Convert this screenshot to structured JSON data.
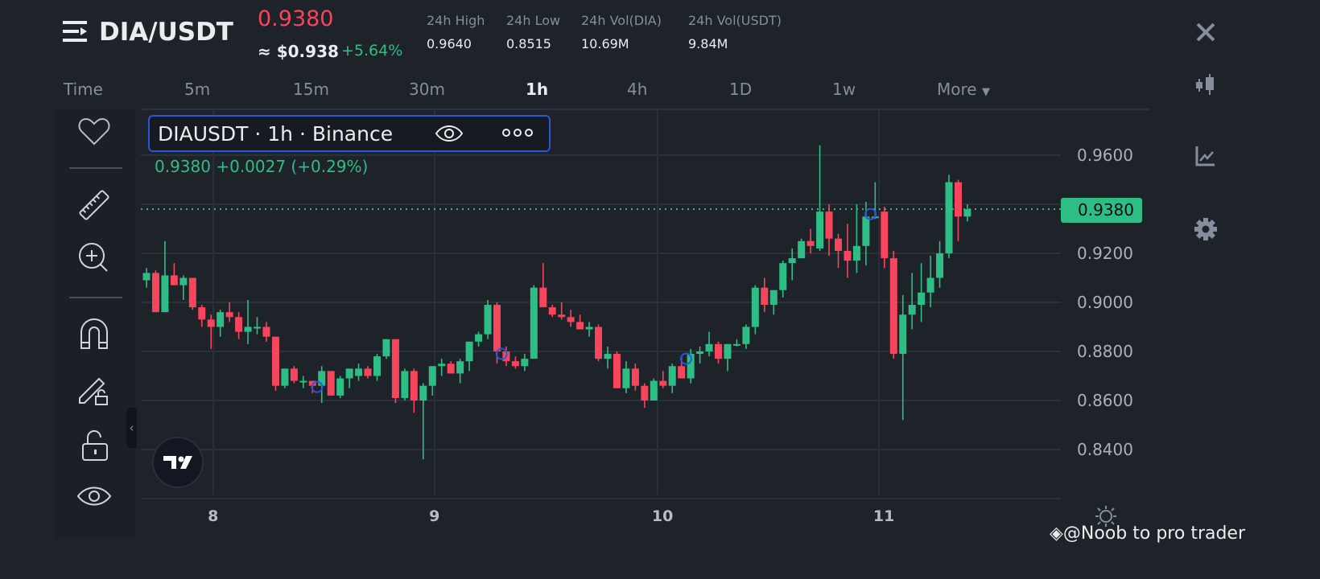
{
  "header": {
    "pair": "DIA/USDT",
    "last_price": "0.9380",
    "usd_price": "≈ $0.938",
    "change_pct": "+5.64%",
    "stats": [
      {
        "label": "24h High",
        "value": "0.9640"
      },
      {
        "label": "24h Low",
        "value": "0.8515"
      },
      {
        "label": "24h Vol(DIA)",
        "value": "10.69M"
      },
      {
        "label": "24h Vol(USDT)",
        "value": "9.84M"
      }
    ]
  },
  "intervals": [
    "Time",
    "5m",
    "15m",
    "30m",
    "1h",
    "4h",
    "1D",
    "1w",
    "More"
  ],
  "active_interval": "1h",
  "legend": {
    "title": "DIAUSDT · 1h · Binance",
    "values": "0.9380  +0.0027 (+0.29%)"
  },
  "current_price_tag": "0.9380",
  "watermark": "@Noob to pro trader",
  "colors": {
    "up": "#2ebd85",
    "down": "#f6465d",
    "accent": "#2c56d6",
    "bg": "#1e2229"
  },
  "chart_data": {
    "type": "candlestick",
    "y_ticks": [
      "0.9600",
      "0.9200",
      "0.9000",
      "0.8800",
      "0.8600",
      "0.8400"
    ],
    "y_tick_values": [
      0.96,
      0.92,
      0.9,
      0.88,
      0.86,
      0.84
    ],
    "x_ticks": [
      {
        "label": "8",
        "index": 7.25
      },
      {
        "label": "9",
        "index": 31.25
      },
      {
        "label": "10",
        "index": 55.4
      },
      {
        "label": "11",
        "index": 79.4
      }
    ],
    "current_price": 0.938,
    "markers": [
      {
        "index": 18.5,
        "price": 0.8655
      },
      {
        "index": 38.5,
        "price": 0.879
      },
      {
        "index": 58.5,
        "price": 0.877
      },
      {
        "index": 78.5,
        "price": 0.936
      }
    ],
    "ohlc": [
      [
        0.909,
        0.914,
        0.906,
        0.912
      ],
      [
        0.912,
        0.913,
        0.896,
        0.896
      ],
      [
        0.896,
        0.925,
        0.896,
        0.911
      ],
      [
        0.911,
        0.916,
        0.907,
        0.907
      ],
      [
        0.907,
        0.911,
        0.901,
        0.91
      ],
      [
        0.91,
        0.91,
        0.897,
        0.898
      ],
      [
        0.898,
        0.899,
        0.89,
        0.893
      ],
      [
        0.893,
        0.895,
        0.881,
        0.89
      ],
      [
        0.89,
        0.897,
        0.886,
        0.896
      ],
      [
        0.896,
        0.9,
        0.892,
        0.894
      ],
      [
        0.894,
        0.896,
        0.885,
        0.888
      ],
      [
        0.888,
        0.901,
        0.883,
        0.89
      ],
      [
        0.89,
        0.894,
        0.887,
        0.89
      ],
      [
        0.89,
        0.892,
        0.884,
        0.886
      ],
      [
        0.886,
        0.886,
        0.864,
        0.866
      ],
      [
        0.866,
        0.873,
        0.865,
        0.873
      ],
      [
        0.873,
        0.874,
        0.867,
        0.868
      ],
      [
        0.868,
        0.87,
        0.865,
        0.868
      ],
      [
        0.868,
        0.868,
        0.863,
        0.866
      ],
      [
        0.866,
        0.874,
        0.859,
        0.872
      ],
      [
        0.872,
        0.872,
        0.862,
        0.862
      ],
      [
        0.862,
        0.87,
        0.861,
        0.869
      ],
      [
        0.869,
        0.872,
        0.865,
        0.873
      ],
      [
        0.87,
        0.875,
        0.868,
        0.873
      ],
      [
        0.873,
        0.874,
        0.869,
        0.87
      ],
      [
        0.87,
        0.879,
        0.868,
        0.878
      ],
      [
        0.878,
        0.885,
        0.877,
        0.885
      ],
      [
        0.885,
        0.885,
        0.859,
        0.861
      ],
      [
        0.861,
        0.873,
        0.86,
        0.872
      ],
      [
        0.872,
        0.873,
        0.855,
        0.86
      ],
      [
        0.86,
        0.867,
        0.836,
        0.866
      ],
      [
        0.866,
        0.874,
        0.862,
        0.874
      ],
      [
        0.874,
        0.877,
        0.87,
        0.875
      ],
      [
        0.875,
        0.876,
        0.871,
        0.871
      ],
      [
        0.871,
        0.877,
        0.867,
        0.876
      ],
      [
        0.876,
        0.884,
        0.872,
        0.884
      ],
      [
        0.884,
        0.888,
        0.882,
        0.887
      ],
      [
        0.887,
        0.901,
        0.885,
        0.899
      ],
      [
        0.899,
        0.9,
        0.875,
        0.88
      ],
      [
        0.88,
        0.882,
        0.874,
        0.876
      ],
      [
        0.876,
        0.878,
        0.873,
        0.874
      ],
      [
        0.874,
        0.879,
        0.872,
        0.877
      ],
      [
        0.877,
        0.907,
        0.877,
        0.906
      ],
      [
        0.906,
        0.916,
        0.898,
        0.898
      ],
      [
        0.898,
        0.899,
        0.894,
        0.895
      ],
      [
        0.895,
        0.9,
        0.893,
        0.894
      ],
      [
        0.894,
        0.897,
        0.89,
        0.892
      ],
      [
        0.892,
        0.895,
        0.889,
        0.889
      ],
      [
        0.889,
        0.892,
        0.886,
        0.89
      ],
      [
        0.89,
        0.891,
        0.876,
        0.877
      ],
      [
        0.877,
        0.882,
        0.873,
        0.879
      ],
      [
        0.879,
        0.88,
        0.865,
        0.865
      ],
      [
        0.865,
        0.876,
        0.863,
        0.873
      ],
      [
        0.873,
        0.875,
        0.864,
        0.866
      ],
      [
        0.866,
        0.867,
        0.857,
        0.86
      ],
      [
        0.86,
        0.869,
        0.86,
        0.868
      ],
      [
        0.868,
        0.872,
        0.865,
        0.866
      ],
      [
        0.866,
        0.875,
        0.863,
        0.874
      ],
      [
        0.874,
        0.878,
        0.869,
        0.869
      ],
      [
        0.869,
        0.881,
        0.867,
        0.879
      ],
      [
        0.879,
        0.882,
        0.875,
        0.88
      ],
      [
        0.88,
        0.888,
        0.878,
        0.883
      ],
      [
        0.883,
        0.884,
        0.875,
        0.877
      ],
      [
        0.877,
        0.883,
        0.872,
        0.883
      ],
      [
        0.883,
        0.885,
        0.882,
        0.883
      ],
      [
        0.883,
        0.891,
        0.881,
        0.89
      ],
      [
        0.89,
        0.907,
        0.887,
        0.906
      ],
      [
        0.906,
        0.91,
        0.896,
        0.899
      ],
      [
        0.899,
        0.905,
        0.895,
        0.905
      ],
      [
        0.905,
        0.917,
        0.902,
        0.916
      ],
      [
        0.916,
        0.922,
        0.909,
        0.918
      ],
      [
        0.918,
        0.926,
        0.918,
        0.925
      ],
      [
        0.925,
        0.93,
        0.92,
        0.923
      ],
      [
        0.922,
        0.964,
        0.921,
        0.937
      ],
      [
        0.937,
        0.94,
        0.919,
        0.926
      ],
      [
        0.926,
        0.928,
        0.914,
        0.921
      ],
      [
        0.921,
        0.932,
        0.91,
        0.917
      ],
      [
        0.917,
        0.94,
        0.912,
        0.923
      ],
      [
        0.923,
        0.941,
        0.915,
        0.935
      ],
      [
        0.935,
        0.949,
        0.934,
        0.935
      ],
      [
        0.937,
        0.939,
        0.914,
        0.918
      ],
      [
        0.918,
        0.921,
        0.877,
        0.879
      ],
      [
        0.879,
        0.903,
        0.852,
        0.895
      ],
      [
        0.895,
        0.912,
        0.889,
        0.899
      ],
      [
        0.899,
        0.916,
        0.892,
        0.904
      ],
      [
        0.904,
        0.919,
        0.898,
        0.91
      ],
      [
        0.91,
        0.925,
        0.906,
        0.92
      ],
      [
        0.92,
        0.952,
        0.918,
        0.949
      ],
      [
        0.949,
        0.95,
        0.925,
        0.935
      ],
      [
        0.935,
        0.94,
        0.933,
        0.938
      ]
    ]
  }
}
